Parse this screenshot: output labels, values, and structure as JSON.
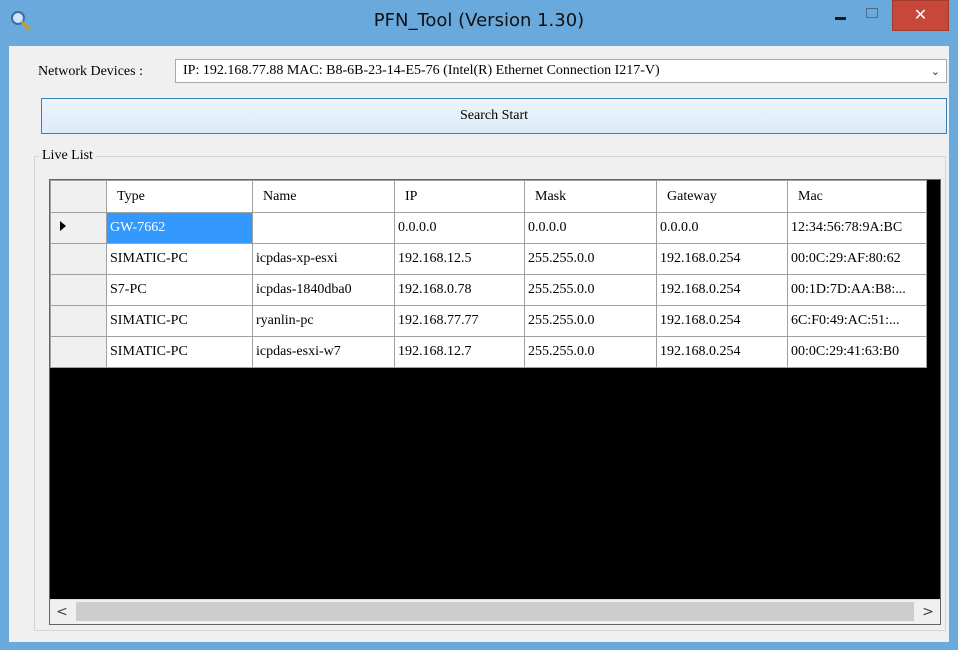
{
  "window": {
    "title": "PFN_Tool (Version 1.30)",
    "app_icon": "magnifier-icon",
    "controls": {
      "minimize_icon": "minimize-icon",
      "maximize_icon": "maximize-icon",
      "close_glyph": "✕"
    },
    "colors": {
      "frame": "#6aa9dc",
      "close": "#c7473b",
      "selection": "#3399ff"
    }
  },
  "network": {
    "label": "Network Devices :",
    "selected": "IP: 192.168.77.88  MAC: B8-6B-23-14-E5-76 (Intel(R) Ethernet Connection I217-V)",
    "arrow_glyph": "⌄"
  },
  "search": {
    "label": "Search Start"
  },
  "live_list": {
    "label": "Live List",
    "current_row_glyph": "▶",
    "columns": [
      "Type",
      "Name",
      "IP",
      "Mask",
      "Gateway",
      "Mac"
    ],
    "rows": [
      [
        "GW-7662",
        "",
        "0.0.0.0",
        "0.0.0.0",
        "0.0.0.0",
        "12:34:56:78:9A:BC"
      ],
      [
        "SIMATIC-PC",
        "icpdas-xp-esxi",
        "192.168.12.5",
        "255.255.0.0",
        "192.168.0.254",
        "00:0C:29:AF:80:62"
      ],
      [
        "S7-PC",
        "icpdas-1840dba0",
        "192.168.0.78",
        "255.255.0.0",
        "192.168.0.254",
        "00:1D:7D:AA:B8:..."
      ],
      [
        "SIMATIC-PC",
        "ryanlin-pc",
        "192.168.77.77",
        "255.255.0.0",
        "192.168.0.254",
        "6C:F0:49:AC:51:..."
      ],
      [
        "SIMATIC-PC",
        "icpdas-esxi-w7",
        "192.168.12.7",
        "255.255.0.0",
        "192.168.0.254",
        "00:0C:29:41:63:B0"
      ]
    ]
  },
  "scrollbar": {
    "left_glyph": "<",
    "right_glyph": ">"
  }
}
